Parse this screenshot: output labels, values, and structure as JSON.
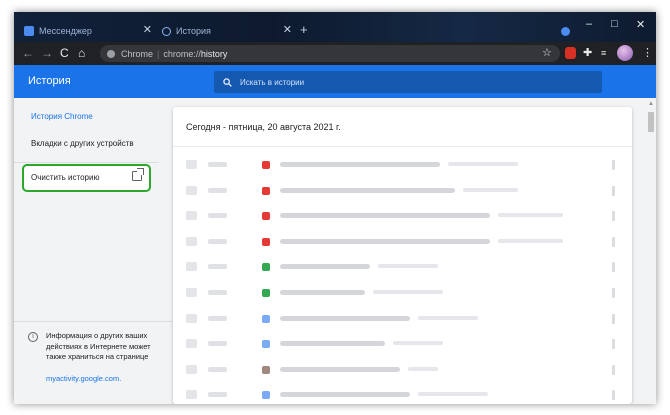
{
  "tabs": [
    {
      "label": "Мессенджер",
      "icon": "messenger-icon",
      "color": "#4a8cf0"
    },
    {
      "label": "История",
      "icon": "history-icon",
      "color": "#8ab4f8"
    }
  ],
  "new_tab_glyph": "+",
  "window_controls": {
    "minimize": "–",
    "maximize": "□",
    "close": "✕"
  },
  "toolbar": {
    "back": "←",
    "forward": "→",
    "reload": "C",
    "home": "⌂",
    "address_site": "Chrome",
    "address_path_prefix": "chrome://",
    "address_path": "history",
    "star": "☆",
    "puzzle": "✚",
    "menu": "⋮"
  },
  "header": {
    "title": "История",
    "search_placeholder": "Искать в истории"
  },
  "sidebar": {
    "items": [
      {
        "label": "История Chrome",
        "active": true
      },
      {
        "label": "Вкладки с других устройств",
        "active": false
      }
    ],
    "clear_button": "Очистить историю",
    "info_text": "Информация о других ваших действиях в Интернете может также храниться на странице",
    "info_link": "myactivity.google.com."
  },
  "main": {
    "date_heading": "Сегодня - пятница, 20 августа 2021 г.",
    "rows": [
      {
        "favicon_color": "#e53935"
      },
      {
        "favicon_color": "#e53935"
      },
      {
        "favicon_color": "#e53935"
      },
      {
        "favicon_color": "#e53935"
      },
      {
        "favicon_color": "#34a853"
      },
      {
        "favicon_color": "#34a853"
      },
      {
        "favicon_color": "#7baaf7"
      },
      {
        "favicon_color": "#7baaf7"
      },
      {
        "favicon_color": "#a1887f"
      },
      {
        "favicon_color": "#7baaf7"
      }
    ]
  },
  "colors": {
    "accent": "#1a73e8",
    "highlight": "#2ba82b"
  }
}
